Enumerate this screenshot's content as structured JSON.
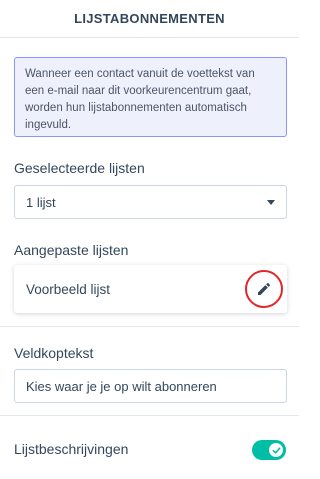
{
  "header": {
    "title": "LIJSTABONNEMENTEN"
  },
  "info": {
    "text": "Wanneer een contact vanuit de voettekst van een e-mail naar dit voorkeurencentrum gaat, worden hun lijstabonnementen automatisch ingevuld."
  },
  "selected_lists": {
    "label": "Geselecteerde lijsten",
    "value": "1 lijst",
    "icon": "chevron-down-icon"
  },
  "custom_lists": {
    "label": "Aangepaste lijsten",
    "items": [
      {
        "name": "Voorbeeld lijst",
        "icon": "pencil-icon"
      }
    ]
  },
  "field_heading": {
    "label": "Veldkoptekst",
    "value": "Kies waar je je op wilt abonneren"
  },
  "list_descriptions": {
    "label": "Lijstbeschrijvingen",
    "enabled": true,
    "icon": "checkmark-icon"
  },
  "colors": {
    "accent_toggle": "#00bda5",
    "info_border": "#8a96ff",
    "info_bg": "#eef0fc",
    "highlight_ring": "#e2262b",
    "text": "#33475b"
  }
}
